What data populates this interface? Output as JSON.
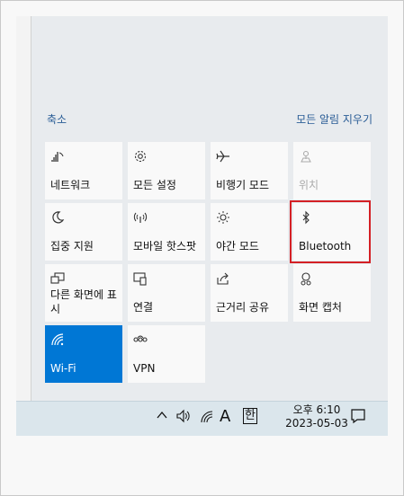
{
  "header": {
    "collapse_label": "축소",
    "clear_all_label": "모든 알림 지우기"
  },
  "tiles": [
    {
      "label": "네트워크",
      "icon": "network-icon"
    },
    {
      "label": "모든 설정",
      "icon": "settings-gear-icon"
    },
    {
      "label": "비행기 모드",
      "icon": "airplane-icon"
    },
    {
      "label": "위치",
      "icon": "location-icon",
      "state": "disabled"
    },
    {
      "label": "집중 지원",
      "icon": "moon-icon"
    },
    {
      "label": "모바일 핫스팟",
      "icon": "hotspot-icon"
    },
    {
      "label": "야간 모드",
      "icon": "brightness-icon"
    },
    {
      "label": "Bluetooth",
      "icon": "bluetooth-icon",
      "highlighted": true
    },
    {
      "label": "다른 화면에 표시",
      "icon": "project-icon"
    },
    {
      "label": "연결",
      "icon": "connect-icon"
    },
    {
      "label": "근거리 공유",
      "icon": "nearby-share-icon"
    },
    {
      "label": "화면 캡처",
      "icon": "screen-snip-icon"
    },
    {
      "label": "Wi-Fi",
      "icon": "wifi-icon",
      "state": "on"
    },
    {
      "label": "VPN",
      "icon": "vpn-icon"
    }
  ],
  "taskbar": {
    "ime_letter": "A",
    "ime_lang": "한",
    "time": "오후 6:10",
    "date": "2023-05-03"
  },
  "colors": {
    "accent": "#0077d5",
    "highlight_border": "#d42025",
    "link": "#2a5d96"
  }
}
